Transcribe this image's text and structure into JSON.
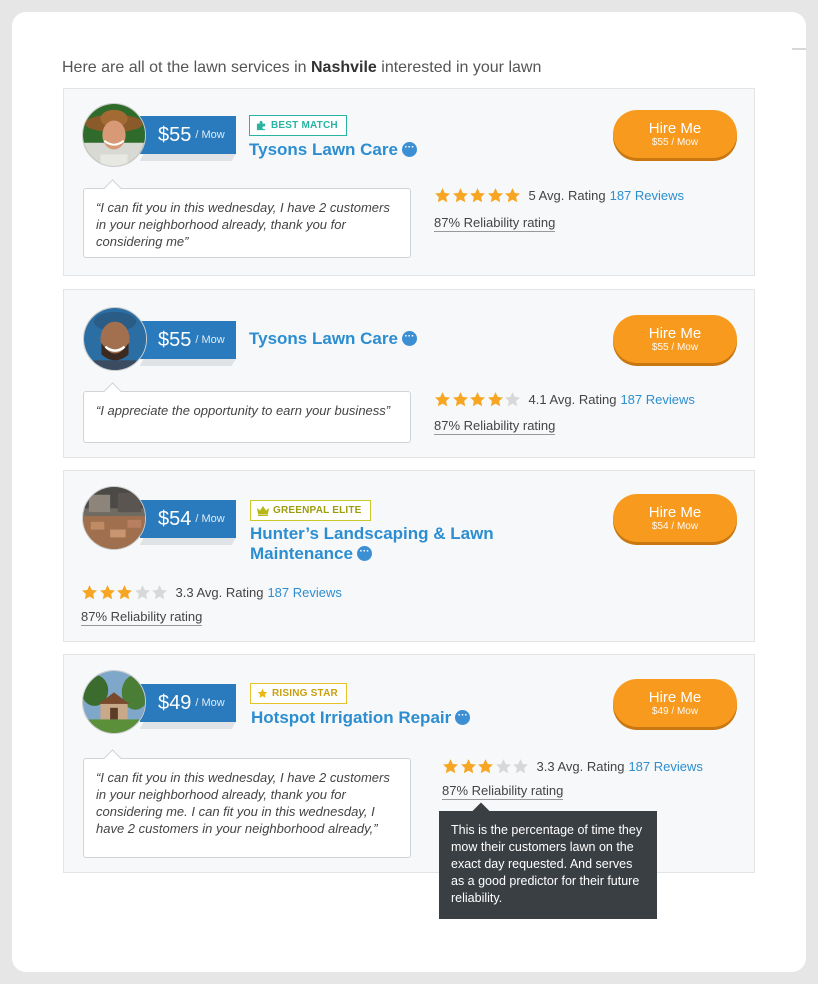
{
  "heading": {
    "prefix": "Here are all ot the lawn services in ",
    "city": "Nashvile",
    "suffix": " interested in your lawn"
  },
  "colors": {
    "accent_blue": "#2a7bbd",
    "link_blue": "#2c8ed1",
    "hire_orange": "#f79a1e",
    "star_filled": "#f6a623",
    "star_empty": "#d8d8d8"
  },
  "providers": [
    {
      "price": "$55",
      "unit": "/ Mow",
      "badge": "BEST MATCH",
      "badge_icon": "puzzle-icon",
      "name": "Tysons Lawn Care",
      "quote": "“I can fit you in this wednesday, I have 2 customers in your neighborhood already, thank you for considering me”",
      "rating_stars": 5,
      "rating_text": "5 Avg. Rating",
      "reviews": "187 Reviews",
      "reliability": "87% Reliability rating",
      "hire_label": "Hire Me",
      "hire_price": "$55 / Mow"
    },
    {
      "price": "$55",
      "unit": "/ Mow",
      "name": "Tysons Lawn Care",
      "quote": "“I appreciate the opportunity to earn your business”",
      "rating_stars": 4,
      "rating_text": "4.1 Avg. Rating",
      "reviews": "187 Reviews",
      "reliability": "87% Reliability rating",
      "hire_label": "Hire Me",
      "hire_price": "$55 / Mow"
    },
    {
      "price": "$54",
      "unit": "/ Mow",
      "badge": "GREENPAL ELITE",
      "badge_icon": "crown-icon",
      "name": "Hunter’s Landscaping & Lawn Maintenance",
      "rating_stars": 3,
      "rating_text": "3.3 Avg. Rating",
      "reviews": "187 Reviews",
      "reliability": "87% Reliability rating",
      "hire_label": "Hire Me",
      "hire_price": "$54 / Mow"
    },
    {
      "price": "$49",
      "unit": "/ Mow",
      "badge": "RISING STAR",
      "badge_icon": "star-icon",
      "name": "Hotspot Irrigation Repair",
      "quote": "“I can fit you in this wednesday, I have 2 customers in your neighborhood already, thank you for considering me. I can fit you in this wednesday, I have 2 customers in your neighborhood already,”",
      "rating_stars": 3,
      "rating_text": "3.3 Avg. Rating",
      "reviews": "187 Reviews",
      "reliability": "87% Reliability rating",
      "hire_label": "Hire Me",
      "hire_price": "$49 / Mow"
    }
  ],
  "tooltip": {
    "text": "This is the percentage of time they mow their customers lawn on the exact day requested. And serves as a good predictor for their future reliability."
  }
}
